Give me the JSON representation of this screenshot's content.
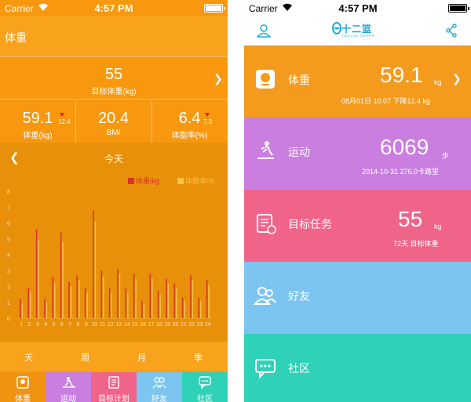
{
  "status_bar": {
    "carrier": "Carrier",
    "time": "4:57 PM"
  },
  "left_screen": {
    "title": "体重",
    "goal": {
      "value": "55",
      "label": "目标体重(kg)"
    },
    "stats": [
      {
        "value": "59.1",
        "label": "体重(kg)",
        "delta": "12.4"
      },
      {
        "value": "20.4",
        "label": "BMI"
      },
      {
        "value": "6.4",
        "label": "体脂率(%)",
        "delta": "7.3"
      }
    ],
    "chart_header": {
      "period": "今天"
    },
    "chart_data": {
      "type": "bar",
      "categories": [
        "1",
        "2",
        "3",
        "4",
        "5",
        "6",
        "7",
        "8",
        "9",
        "10",
        "11",
        "12",
        "13",
        "14",
        "15",
        "16",
        "17",
        "18",
        "19",
        "20",
        "21",
        "22",
        "23",
        "24"
      ],
      "series": [
        {
          "name": "体重/kg",
          "values": [
            1.2,
            1.9,
            5.6,
            1.2,
            2.6,
            5.4,
            2.3,
            2.7,
            1.9,
            6.8,
            3.0,
            1.9,
            3.1,
            1.9,
            2.8,
            1.1,
            2.8,
            1.7,
            2.5,
            2.2,
            1.3,
            2.7,
            1.3,
            2.4
          ]
        },
        {
          "name": "体脂率/%",
          "values": [
            0.9,
            1.6,
            4.9,
            1.0,
            2.2,
            4.8,
            2.0,
            2.4,
            1.6,
            6.1,
            2.6,
            1.6,
            2.8,
            1.6,
            2.5,
            0.9,
            2.5,
            1.5,
            2.2,
            1.9,
            1.1,
            2.4,
            1.1,
            2.1
          ]
        }
      ],
      "ylim": [
        0,
        8
      ],
      "yticks": [
        "0",
        "1",
        "2",
        "3",
        "4",
        "5",
        "6",
        "7",
        "8"
      ],
      "grid": false,
      "legend": "top-right"
    },
    "period_tabs": [
      "天",
      "周",
      "月",
      "季"
    ],
    "tabbar": [
      {
        "label": "体重",
        "color": "#f09310",
        "icon": "scale-icon"
      },
      {
        "label": "运动",
        "color": "#c97ee0",
        "icon": "treadmill-icon"
      },
      {
        "label": "目标计划",
        "color": "#f1648a",
        "icon": "clipboard-icon"
      },
      {
        "label": "好友",
        "color": "#7cc5f1",
        "icon": "friends-icon"
      },
      {
        "label": "社区",
        "color": "#2fd1b7",
        "icon": "chat-icon"
      }
    ],
    "colors": {
      "weight_bar": "#d9342b",
      "fat_bar": "#f7c246"
    }
  },
  "right_screen": {
    "logo_text": "十二篮",
    "logo_sub": "TWELVE SKEPS",
    "cards": [
      {
        "name": "weight",
        "title": "体重",
        "value": "59.1",
        "unit": "kg",
        "sub": "08月01日 10:07 下降12.4 kg",
        "color": "#f49a1d",
        "icon": "scale-icon"
      },
      {
        "name": "exercise",
        "title": "运动",
        "value": "6069",
        "unit": "步",
        "sub": "2014-10-31 276.0卡路里",
        "color": "#c97ee0",
        "icon": "treadmill-icon"
      },
      {
        "name": "goal",
        "title": "目标任务",
        "value": "55",
        "unit": "kg",
        "sub": "72天 目标体重",
        "color": "#f1648a",
        "icon": "clipboard-icon"
      },
      {
        "name": "friends",
        "title": "好友",
        "value": "",
        "unit": "",
        "sub": "",
        "color": "#7cc5f1",
        "icon": "friends-icon"
      },
      {
        "name": "community",
        "title": "社区",
        "value": "",
        "unit": "",
        "sub": "",
        "color": "#2fd1b7",
        "icon": "chat-icon"
      }
    ]
  }
}
